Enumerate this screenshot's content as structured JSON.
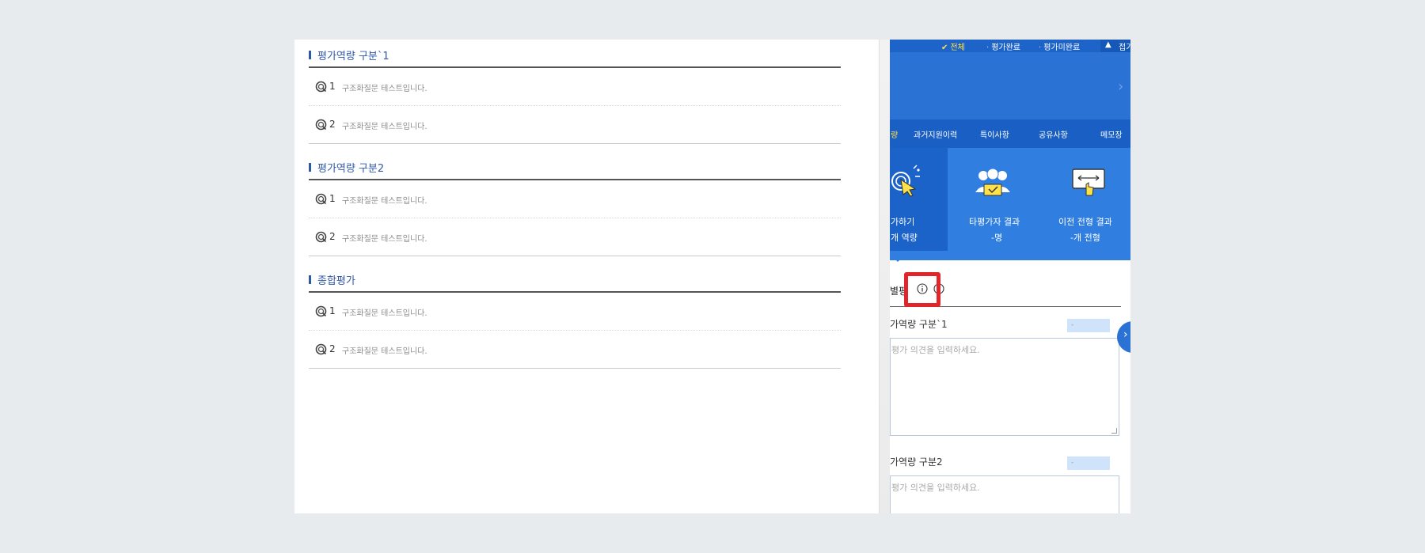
{
  "left_panel": {
    "sections": [
      {
        "title": "평가역량 구분`1",
        "questions": [
          {
            "num": "1",
            "text": "구조화질문 테스트입니다."
          },
          {
            "num": "2",
            "text": "구조화질문 테스트입니다."
          }
        ]
      },
      {
        "title": "평가역량 구분2",
        "questions": [
          {
            "num": "1",
            "text": "구조화질문 테스트입니다."
          },
          {
            "num": "2",
            "text": "구조화질문 테스트입니다."
          }
        ]
      },
      {
        "title": "종합평가",
        "questions": [
          {
            "num": "1",
            "text": "구조화질문 테스트입니다."
          },
          {
            "num": "2",
            "text": "구조화질문 테스트입니다."
          }
        ]
      }
    ]
  },
  "right_panel": {
    "filters": {
      "all": "전체",
      "done": "평가완료",
      "not_done": "평가미완료",
      "collapse": "접기"
    },
    "tabs": [
      "량",
      "과거지원이력",
      "특이사항",
      "공유사항",
      "메모장"
    ],
    "cards": [
      {
        "label": "가하기",
        "sub": "개 역량"
      },
      {
        "label": "타평가자 결과",
        "sub": "-명"
      },
      {
        "label": "이전 전형 결과",
        "sub": "-개 전형"
      }
    ],
    "eval_title": "별평",
    "categories": [
      {
        "label": "가역량 구분`1",
        "score": "-",
        "placeholder": "평가 의견을 입력하세요."
      },
      {
        "label": "가역량 구분2",
        "score": "-",
        "placeholder": "평가 의견을 입력하세요."
      }
    ]
  },
  "colors": {
    "primary_blue": "#2a72d4",
    "dark_blue": "#1a5fc4",
    "section_title": "#2f58a8",
    "highlight": "#e0262b",
    "page_bg": "#e7ebee"
  },
  "icons": [
    "q-badge-icon",
    "chevron-right-icon",
    "checkmark-icon",
    "collapse-arrow-icon",
    "evaluate-pointer-icon",
    "evaluators-group-icon",
    "previous-stage-screen-icon",
    "info-icon"
  ]
}
